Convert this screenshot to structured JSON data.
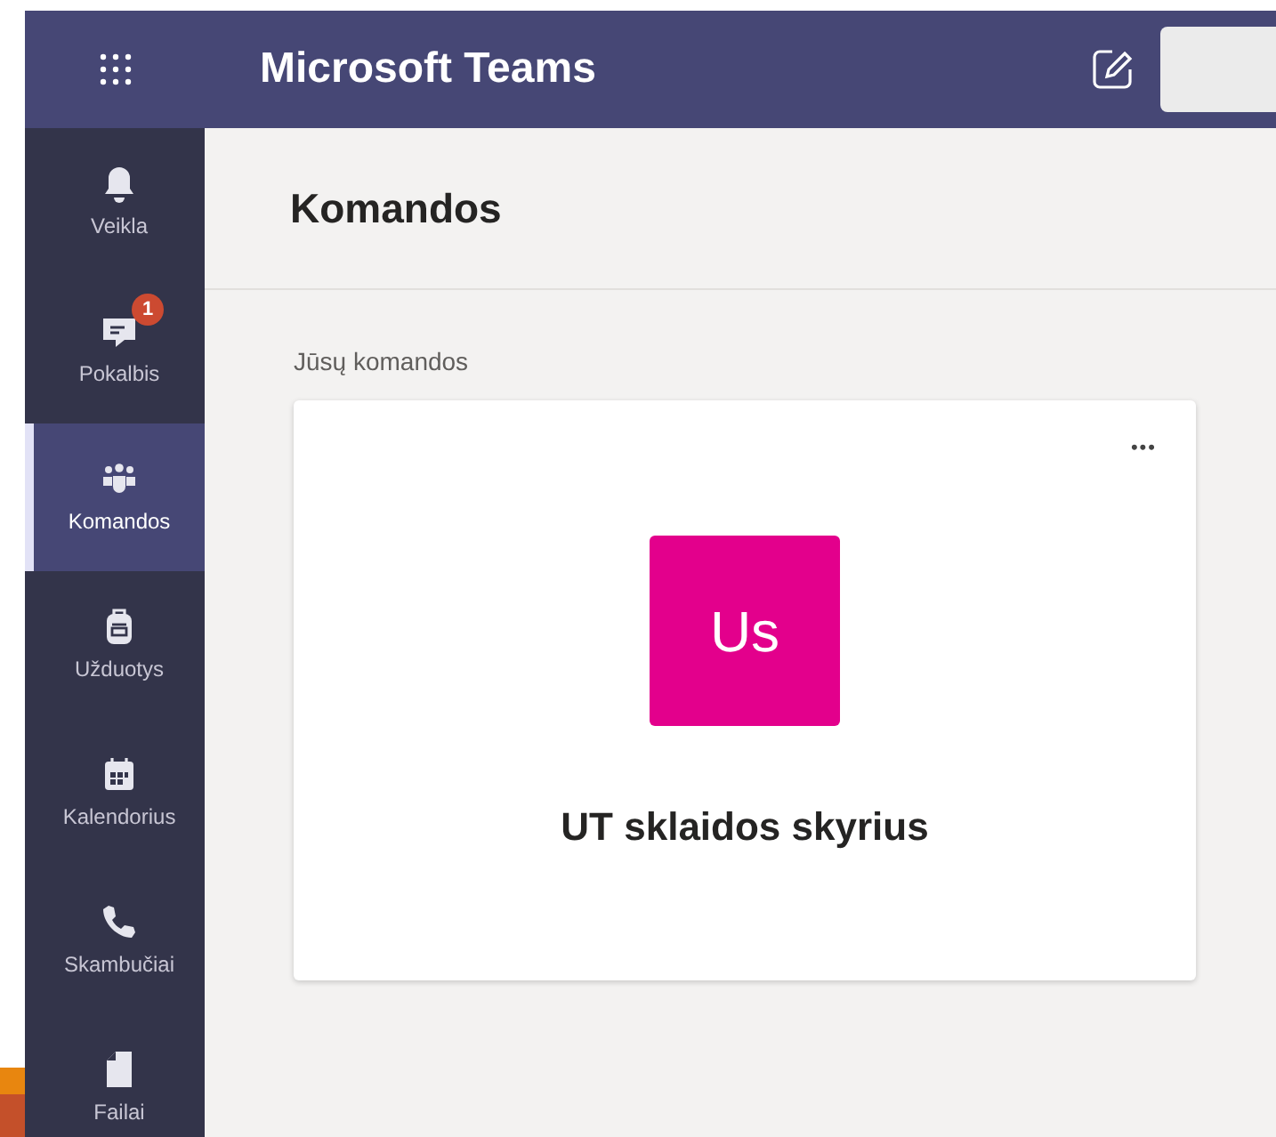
{
  "app": {
    "title": "Microsoft Teams"
  },
  "sidebar": {
    "items": [
      {
        "label": "Veikla",
        "selected": false
      },
      {
        "label": "Pokalbis",
        "selected": false,
        "badge": "1"
      },
      {
        "label": "Komandos",
        "selected": true
      },
      {
        "label": "Užduotys",
        "selected": false
      },
      {
        "label": "Kalendorius",
        "selected": false
      },
      {
        "label": "Skambučiai",
        "selected": false
      },
      {
        "label": "Failai",
        "selected": false
      }
    ]
  },
  "page": {
    "title": "Komandos",
    "section": "Jūsų komandos",
    "teams": [
      {
        "initials": "Us",
        "name": "UT sklaidos skyrius",
        "color": "#e3008c",
        "menu": "•••"
      }
    ]
  }
}
